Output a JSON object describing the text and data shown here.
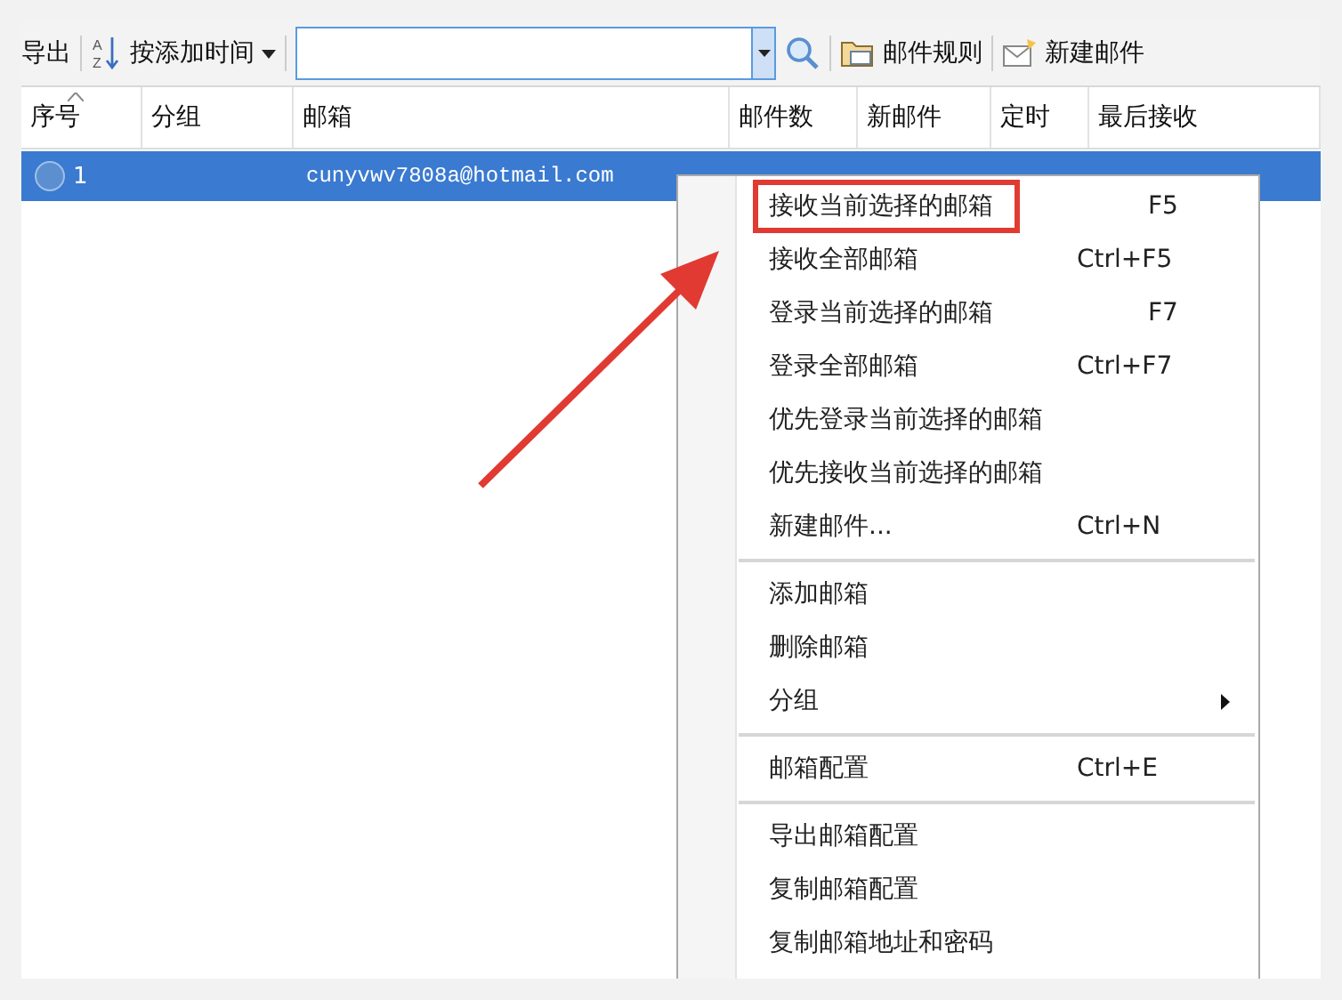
{
  "toolbar": {
    "export_label": "导出",
    "sort": {
      "label": "按添加时间",
      "sort_icon_text": [
        "A",
        "Z"
      ]
    },
    "rules_button": "邮件规则",
    "new_mail_button": "新建邮件"
  },
  "table": {
    "columns": [
      "序号",
      "分组",
      "邮箱",
      "邮件数",
      "新邮件",
      "定时",
      "最后接收"
    ],
    "rows": [
      {
        "selected": true,
        "cells": [
          "1",
          "",
          "cunyvwv7808a@hotmail.com"
        ]
      }
    ]
  },
  "context_menu": {
    "items": [
      {
        "kind": "item",
        "label": "接收当前选择的邮箱",
        "shortcut": "F5",
        "highlighted": true
      },
      {
        "kind": "item",
        "label": "接收全部邮箱",
        "shortcut": "Ctrl+F5",
        "highlighted": false
      },
      {
        "kind": "item",
        "label": "登录当前选择的邮箱",
        "shortcut": "F7",
        "highlighted": false
      },
      {
        "kind": "item",
        "label": "登录全部邮箱",
        "shortcut": "Ctrl+F7",
        "highlighted": false
      },
      {
        "kind": "item",
        "label": "优先登录当前选择的邮箱",
        "highlighted": false
      },
      {
        "kind": "item",
        "label": "优先接收当前选择的邮箱",
        "highlighted": false
      },
      {
        "kind": "item",
        "label": "新建邮件...",
        "shortcut": "Ctrl+N",
        "highlighted": false
      },
      {
        "kind": "separator"
      },
      {
        "kind": "item",
        "label": "添加邮箱",
        "highlighted": false
      },
      {
        "kind": "item",
        "label": "删除邮箱",
        "highlighted": false
      },
      {
        "kind": "submenu",
        "label": "分组",
        "highlighted": false
      },
      {
        "kind": "separator"
      },
      {
        "kind": "item",
        "label": "邮箱配置",
        "shortcut": "Ctrl+E",
        "highlighted": false
      },
      {
        "kind": "separator"
      },
      {
        "kind": "item",
        "label": "导出邮箱配置",
        "highlighted": false
      },
      {
        "kind": "item",
        "label": "复制邮箱配置",
        "highlighted": false
      },
      {
        "kind": "item",
        "label": "复制邮箱地址和密码",
        "highlighted": false
      }
    ]
  }
}
